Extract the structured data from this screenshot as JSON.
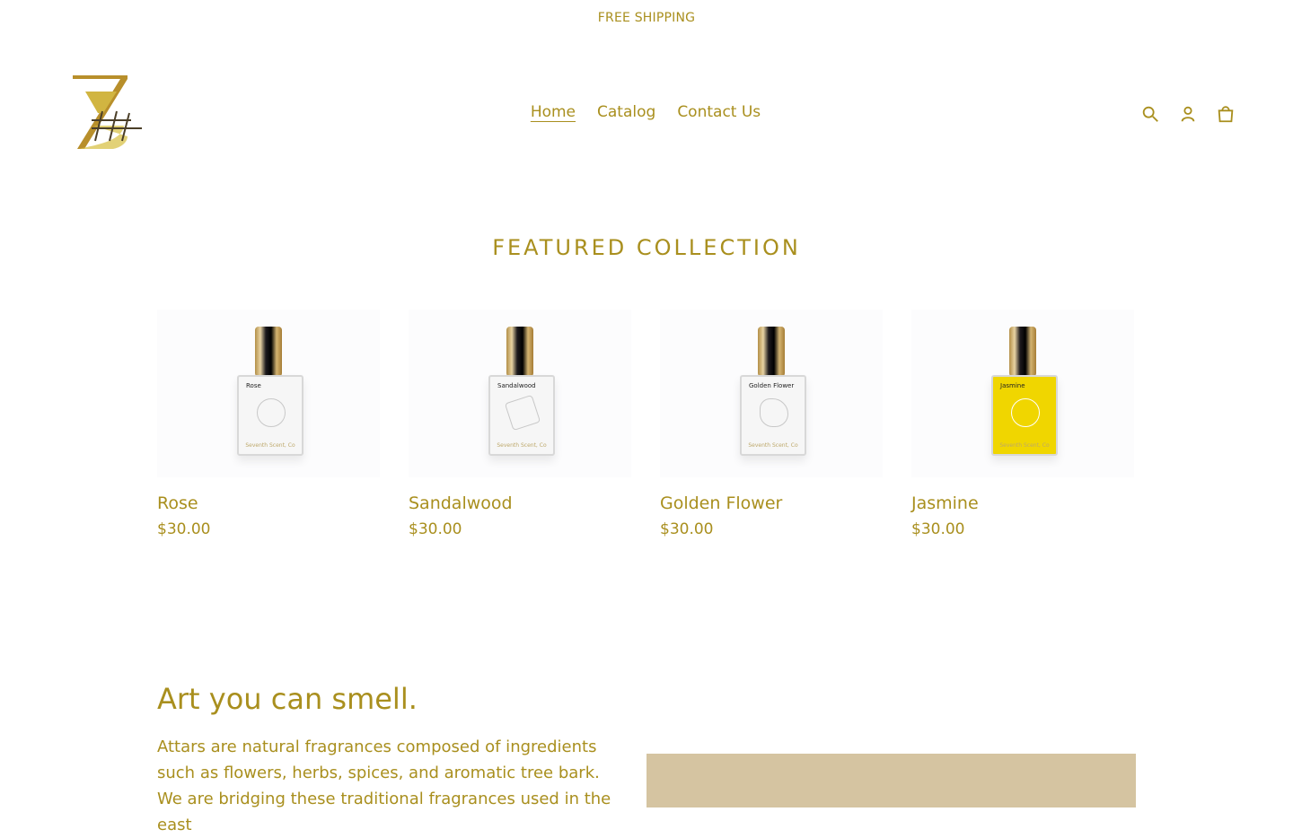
{
  "announcement": "FREE SHIPPING",
  "nav": {
    "home": "Home",
    "catalog": "Catalog",
    "contact": "Contact Us"
  },
  "section_title": "FEATURED COLLECTION",
  "products": [
    {
      "title": "Rose",
      "price": "$30.00",
      "label": "Rose"
    },
    {
      "title": "Sandalwood",
      "price": "$30.00",
      "label": "Sandalwood"
    },
    {
      "title": "Golden Flower",
      "price": "$30.00",
      "label": "Golden Flower"
    },
    {
      "title": "Jasmine",
      "price": "$30.00",
      "label": "Jasmine"
    }
  ],
  "bottle_brand": "Seventh Scent, Co",
  "story": {
    "title": "Art you can smell.",
    "text": "Attars are natural fragrances composed of ingredients such as flowers, herbs, spices, and aromatic tree bark. We are bridging these traditional fragrances used in the east"
  },
  "colors": {
    "accent": "#a98f1e",
    "image_bg": "#d5c4a1",
    "jasmine_liquid": "#f0d600"
  },
  "icons": {
    "search": "search-icon",
    "account": "account-icon",
    "cart": "cart-icon"
  }
}
